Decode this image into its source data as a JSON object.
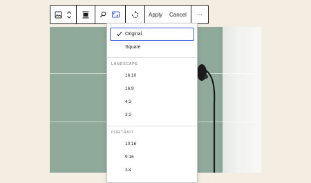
{
  "toolbar": {
    "apply_label": "Apply",
    "cancel_label": "Cancel",
    "more_label": "⋯"
  },
  "aspect_menu": {
    "options": [
      {
        "label": "Original",
        "selected": true
      },
      {
        "label": "Square"
      }
    ],
    "landscape": {
      "heading": "LANDSCAPE",
      "options": [
        "16:10",
        "16:9",
        "4:3",
        "3:2"
      ]
    },
    "portrait": {
      "heading": "PORTRAIT",
      "options": [
        "10:16",
        "9:16",
        "3:4"
      ]
    }
  },
  "colors": {
    "accent": "#3858e9",
    "canvas_background": "#f3ede2",
    "image_wall": "#8fa99b"
  }
}
